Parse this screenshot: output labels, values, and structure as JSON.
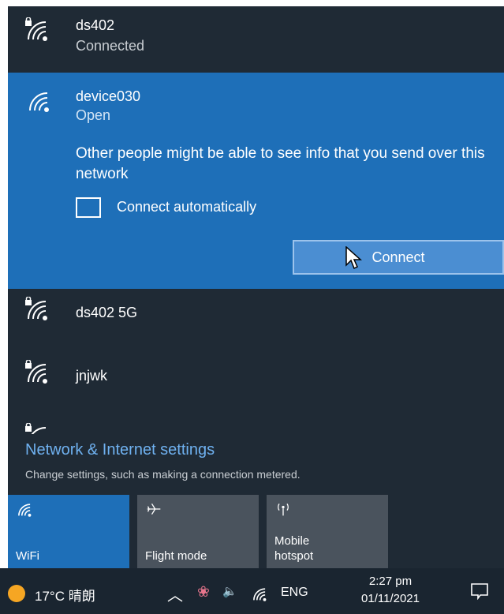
{
  "networks": [
    {
      "name": "ds402",
      "status": "Connected",
      "secured": true
    },
    {
      "name": "device030",
      "status": "Open",
      "secured": false,
      "warning": "Other people might be able to see info that you send over this network",
      "connect_automatically_label": "Connect automatically",
      "connect_automatically_checked": false,
      "connect_label": "Connect"
    },
    {
      "name": "ds402 5G",
      "secured": true
    },
    {
      "name": "jnjwk",
      "secured": true
    },
    {
      "name": "",
      "secured": true
    }
  ],
  "settings": {
    "title": "Network & Internet settings",
    "subtitle": "Change settings, such as making a connection metered."
  },
  "tiles": [
    {
      "label": "WiFi",
      "icon": "wifi-icon",
      "active": true
    },
    {
      "label": "Flight mode",
      "icon": "airplane-icon",
      "active": false
    },
    {
      "label": "Mobile\nhotspot",
      "icon": "hotspot-icon",
      "active": false
    }
  ],
  "taskbar": {
    "weather": "17°C 晴朗",
    "language": "ENG",
    "time": "2:27 pm",
    "date": "01/11/2021",
    "icons": [
      "weather-sun-icon",
      "chevron-up-icon",
      "flower-app-icon",
      "volume-icon",
      "wifi-icon",
      "notification-icon"
    ]
  },
  "colors": {
    "flyout_bg": "#1f2a35",
    "selected_bg": "#1e6fb8",
    "accent_link": "#6fb1f0",
    "tile_active": "#1e6fb8",
    "tile_inactive": "#4a535d",
    "taskbar_bg": "#1a2530"
  }
}
